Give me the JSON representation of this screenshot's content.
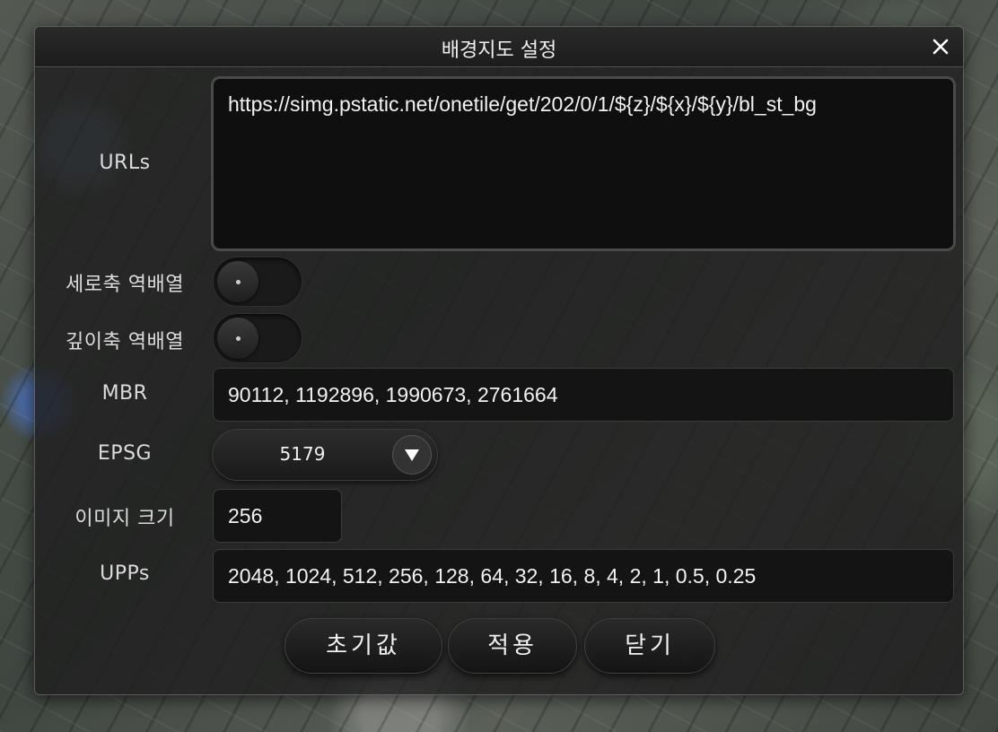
{
  "dialog": {
    "title": "배경지도 설정"
  },
  "form": {
    "urls": {
      "label": "URLs",
      "value": "https://simg.pstatic.net/onetile/get/202/0/1/${z}/${x}/${y}/bl_st_bg"
    },
    "invert_vertical": {
      "label": "세로축 역배열",
      "on": false
    },
    "invert_depth": {
      "label": "깊이축 역배열",
      "on": false
    },
    "mbr": {
      "label": "MBR",
      "value": "90112, 1192896, 1990673, 2761664"
    },
    "epsg": {
      "label": "EPSG",
      "value": "5179"
    },
    "image_size": {
      "label": "이미지 크기",
      "value": "256"
    },
    "upps": {
      "label": "UPPs",
      "value": "2048, 1024, 512, 256, 128, 64, 32, 16, 8, 4, 2, 1, 0.5, 0.25"
    }
  },
  "buttons": {
    "reset": "초기값",
    "apply": "적용",
    "close": "닫기"
  },
  "icons": {
    "close": "close-icon",
    "dropdown": "triangle-down-icon"
  }
}
